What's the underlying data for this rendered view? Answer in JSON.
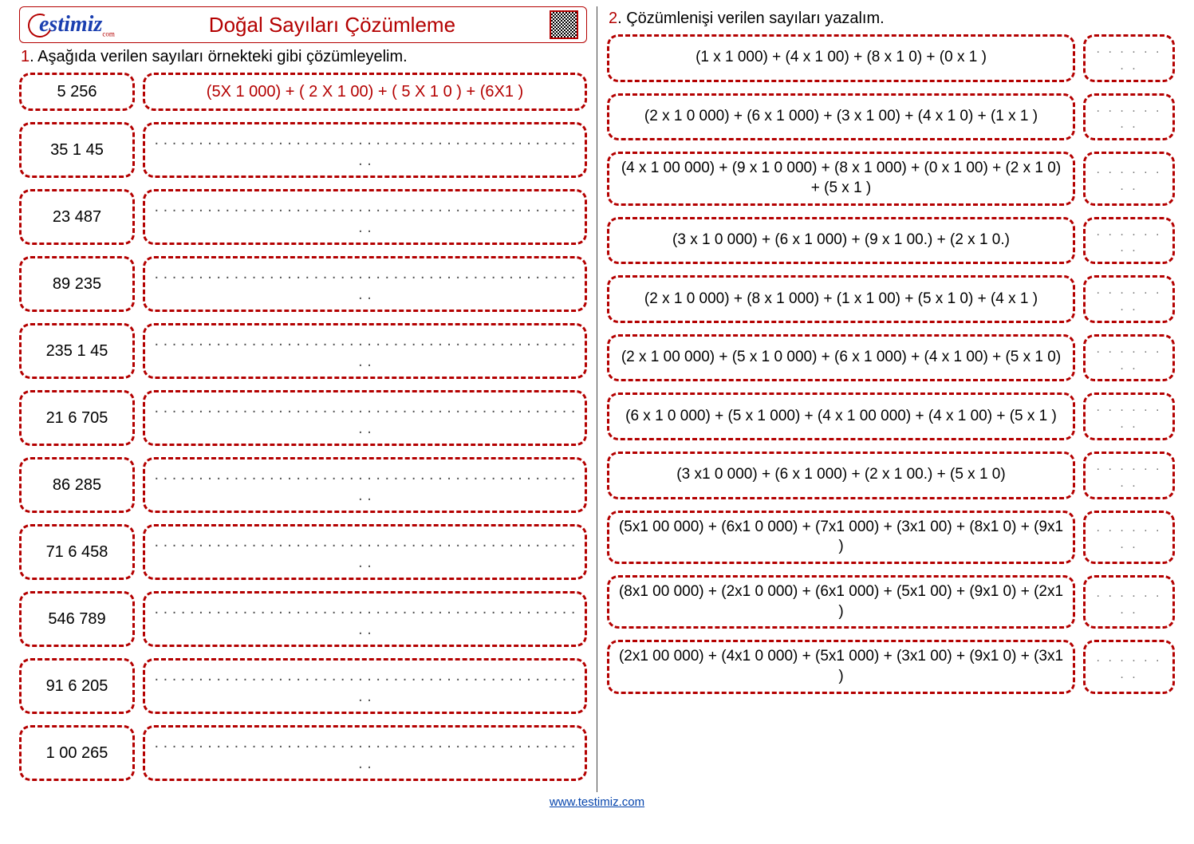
{
  "header": {
    "logo_text": "estimiz",
    "logo_sub": "com",
    "title": "Doğal Sayıları Çözümleme"
  },
  "section1": {
    "num": "1",
    "instruction": ". Aşağıda verilen sayıları örnekteki gibi çözümleyelim.",
    "rows": [
      {
        "number": "5 256",
        "expansion": "(5X 1  000) + ( 2 X 1 00) + ( 5 X 1 0 ) + (6X1 )",
        "is_example": true
      },
      {
        "number": "35 1 45",
        "expansion": ". . . . . . . . . . . . . . . . . . . . . . . . . . . . . . . . . . . . . . . . . . . . . . . . . .",
        "is_example": false
      },
      {
        "number": "23 487",
        "expansion": ". . . . . . . . . . . . . . . . . . . . . . . . . . . . . . . . . . . . . . . . . . . . . . . . . .",
        "is_example": false
      },
      {
        "number": "89 235",
        "expansion": ". . . . . . . . . . . . . . . . . . . . . . . . . . . . . . . . . . . . . . . . . . . . . . . . . .",
        "is_example": false
      },
      {
        "number": "235 1 45",
        "expansion": ". . . . . . . . . . . . . . . . . . . . . . . . . . . . . . . . . . . . . . . . . . . . . . . . . .",
        "is_example": false
      },
      {
        "number": "21 6 705",
        "expansion": ". . . . . . . . . . . . . . . . . . . . . . . . . . . . . . . . . . . . . . . . . . . . . . . . . .",
        "is_example": false
      },
      {
        "number": "86 285",
        "expansion": ". . . . . . . . . . . . . . . . . . . . . . . . . . . . . . . . . . . . . . . . . . . . . . . . . .",
        "is_example": false
      },
      {
        "number": "71 6 458",
        "expansion": ". . . . . . . . . . . . . . . . . . . . . . . . . . . . . . . . . . . . . . . . . . . . . . . . . .",
        "is_example": false
      },
      {
        "number": "546 789",
        "expansion": ". . . . . . . . . . . . . . . . . . . . . . . . . . . . . . . . . . . . . . . . . . . . . . . . . .",
        "is_example": false
      },
      {
        "number": "91 6 205",
        "expansion": ". . . . . . . . . . . . . . . . . . . . . . . . . . . . . . . . . . . . . . . . . . . . . . . . . .",
        "is_example": false
      },
      {
        "number": "1 00 265",
        "expansion": ". . . . . . . . . . . . . . . . . . . . . . . . . . . . . . . . . . . . . . . . . . . . . . . . . .",
        "is_example": false
      }
    ]
  },
  "section2": {
    "num": "2",
    "instruction": ". Çözümlenişi verilen sayıları yazalım.",
    "dots": ". . . . . . . .",
    "rows": [
      {
        "expr": "(1  x 1 000) + (4 x 1 00) + (8  x 1 0) + (0 x 1 )"
      },
      {
        "expr": "(2 x 1 0 000) + (6 x 1 000) + (3 x 1 00) + (4 x 1 0) + (1  x 1 )"
      },
      {
        "expr": "(4 x 1 00 000) + (9 x 1 0 000) + (8 x 1 000) + (0 x 1 00) + (2 x 1 0) + (5 x 1 )"
      },
      {
        "expr": "(3 x 1 0 000) + (6 x 1 000) + (9 x 1 00.) + (2 x 1 0.)"
      },
      {
        "expr": "(2 x 1 0 000) + (8 x 1  000) + (1  x 1 00) + (5 x 1 0) + (4 x 1 )"
      },
      {
        "expr": "(2 x 1 00 000) + (5 x 1 0 000) + (6 x 1 000) + (4 x 1 00) + (5  x 1 0)"
      },
      {
        "expr": "(6 x 1 0 000) + (5 x 1 000) + (4 x 1 00 000) + (4 x 1 00) + (5  x 1 )"
      },
      {
        "expr": "(3 x1 0 000) + (6 x 1 000) + (2  x 1 00.) + (5 x 1 0)"
      },
      {
        "expr": "(5x1 00 000) + (6x1 0 000) + (7x1 000) + (3x1 00) + (8x1 0) + (9x1 )"
      },
      {
        "expr": "(8x1 00 000) + (2x1 0 000) + (6x1 000) + (5x1 00) + (9x1 0) + (2x1 )"
      },
      {
        "expr": "(2x1 00 000) + (4x1 0 000) + (5x1 000) + (3x1 00) + (9x1 0) + (3x1 )"
      }
    ]
  },
  "footer": {
    "link": "www.testimiz.com"
  }
}
